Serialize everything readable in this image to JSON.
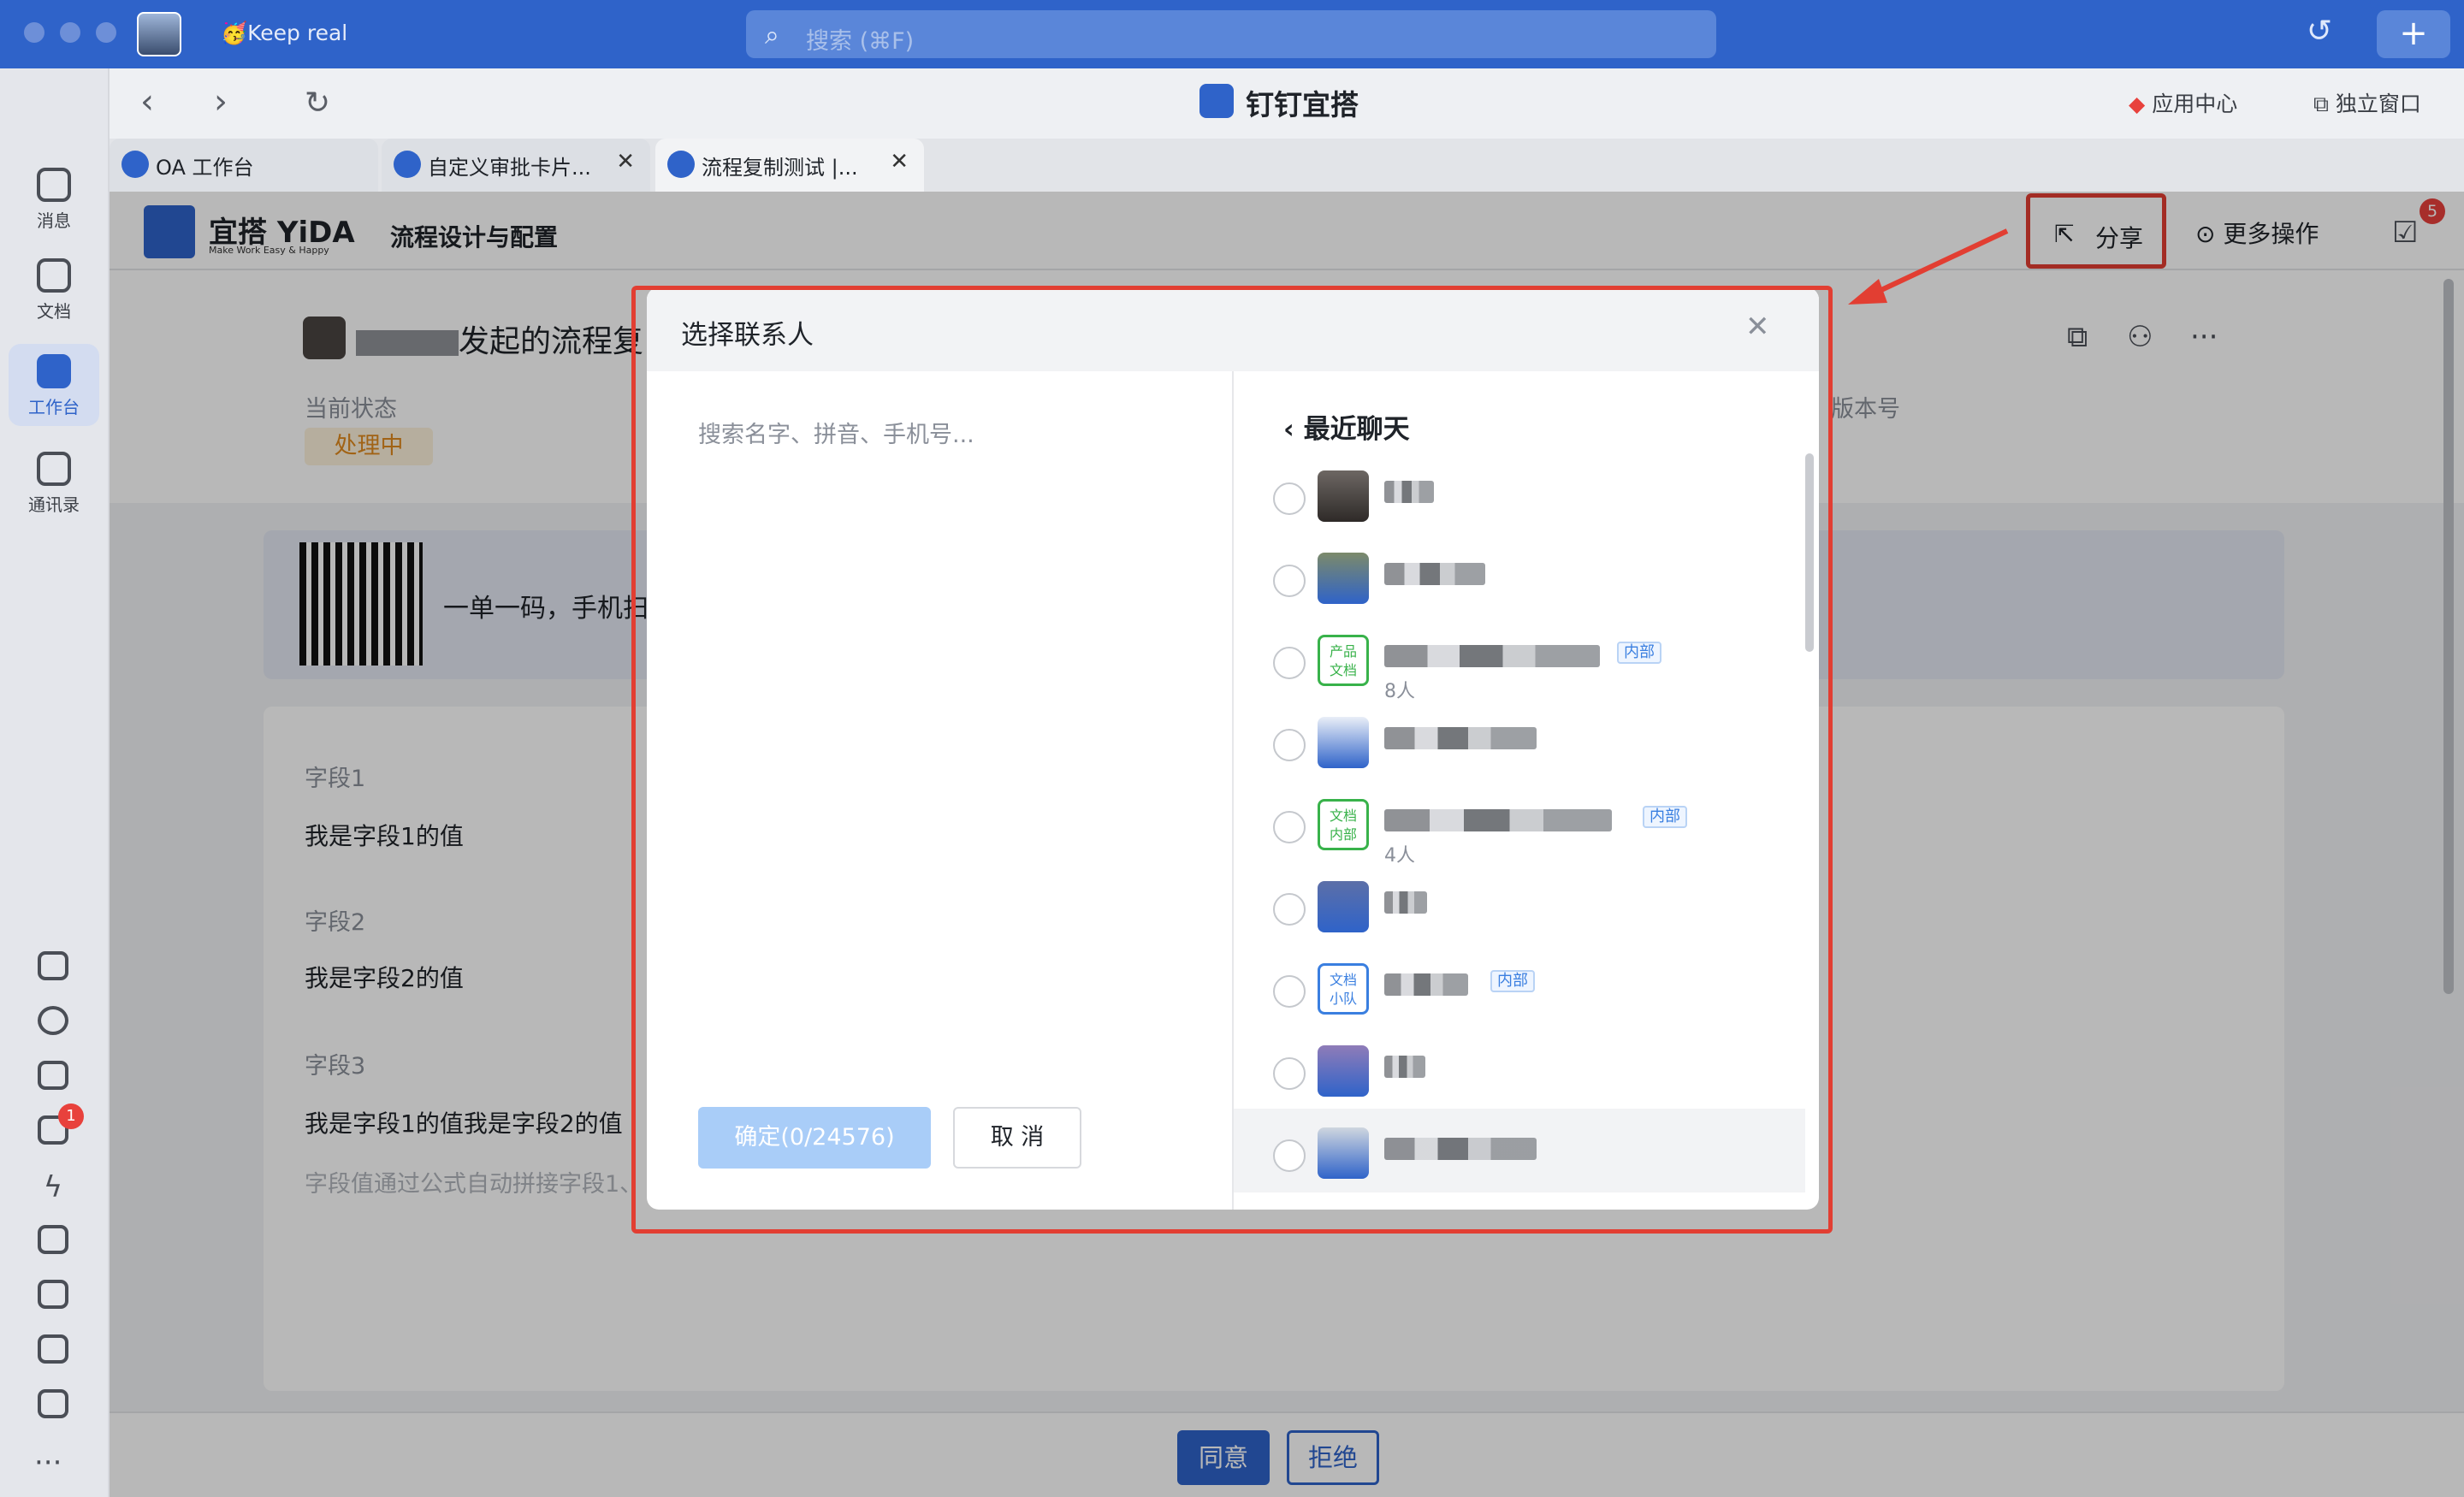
{
  "topbar": {
    "keep_real": "Keep real",
    "search_placeholder": "搜索 (⌘F)"
  },
  "rail": {
    "items": [
      "消息",
      "文档",
      "工作台",
      "通讯录"
    ],
    "todo_badge": "1"
  },
  "app": {
    "title": "钉钉宜搭",
    "app_center": "应用中心",
    "standalone": "独立窗口"
  },
  "tabs": [
    {
      "label": "OA 工作台"
    },
    {
      "label": "自定义审批卡片...",
      "close": "✕"
    },
    {
      "label": "流程复制测试 |...",
      "close": "✕"
    }
  ],
  "page": {
    "logo_text": "宜搭 YiDA",
    "logo_sub": "Make Work Easy & Happy",
    "title": "流程设计与配置",
    "share": "分享",
    "more_ops": "更多操作",
    "task_badge": "5"
  },
  "process": {
    "name": "发起的流程复",
    "status_label": "当前状态",
    "status": "处理中",
    "version_label": "版本号",
    "qr_text": "一单一码，手机扫"
  },
  "fields": [
    {
      "label": "字段1",
      "value": "我是字段1的值"
    },
    {
      "label": "字段2",
      "value": "我是字段2的值"
    },
    {
      "label": "字段3",
      "value": "我是字段1的值我是字段2的值"
    }
  ],
  "field_hint": "字段值通过公式自动拼接字段1、",
  "actions": {
    "agree": "同意",
    "reject": "拒绝"
  },
  "modal": {
    "title": "选择联系人",
    "search_placeholder": "搜索名字、拼音、手机号...",
    "confirm": "确定(0/24576)",
    "cancel": "取 消",
    "recent_header": "最近聊天",
    "contacts": [
      {
        "type": "person",
        "tag": "",
        "sub": ""
      },
      {
        "type": "person",
        "tag": "",
        "sub": ""
      },
      {
        "type": "group",
        "group_label": "产品\n文档",
        "tag": "内部",
        "sub": "8人"
      },
      {
        "type": "person",
        "tag": "",
        "sub": ""
      },
      {
        "type": "group",
        "group_label": "文档\n内部",
        "tag": "内部",
        "sub": "4人"
      },
      {
        "type": "person",
        "tag": "",
        "sub": ""
      },
      {
        "type": "group",
        "group_label": "文档\n小队",
        "tag": "内部",
        "sub": ""
      },
      {
        "type": "person",
        "tag": "",
        "sub": ""
      },
      {
        "type": "person",
        "tag": "",
        "sub": ""
      }
    ]
  },
  "colors": {
    "brand": "#2f63c9",
    "highlight_red": "#e23e32",
    "status_orange": "#e08a1e"
  }
}
